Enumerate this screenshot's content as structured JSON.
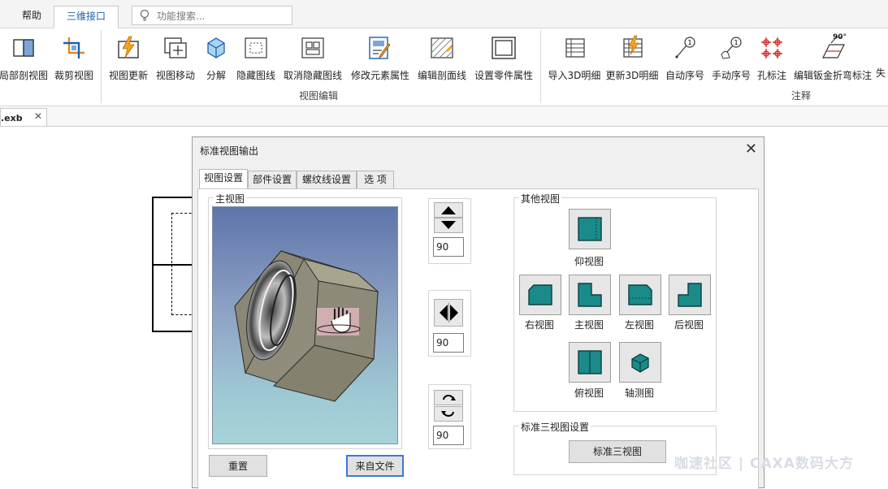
{
  "ribbon_tabs": {
    "help": "帮助",
    "three_d": "三维接口"
  },
  "search": {
    "placeholder": "功能搜索..."
  },
  "ribbon": {
    "left_buttons": [
      {
        "label": "局部剖视图",
        "icon": "partial-section-icon"
      },
      {
        "label": "裁剪视图",
        "icon": "crop-view-icon"
      }
    ],
    "view_edit_buttons": [
      {
        "label": "视图更新",
        "icon": "view-update-icon"
      },
      {
        "label": "视图移动",
        "icon": "view-move-icon"
      },
      {
        "label": "分解",
        "icon": "explode-icon"
      },
      {
        "label": "隐藏图线",
        "icon": "hide-lines-icon"
      },
      {
        "label": "取消隐藏图线",
        "icon": "unhide-lines-icon"
      },
      {
        "label": "修改元素属性",
        "icon": "edit-element-props-icon"
      },
      {
        "label": "编辑剖面线",
        "icon": "edit-hatch-icon"
      },
      {
        "label": "设置零件属性",
        "icon": "set-part-props-icon"
      }
    ],
    "annotation_buttons": [
      {
        "label": "导入3D明细",
        "icon": "import-3d-bom-icon"
      },
      {
        "label": "更新3D明细",
        "icon": "update-3d-bom-icon"
      },
      {
        "label": "自动序号",
        "icon": "auto-balloon-icon"
      },
      {
        "label": "手动序号",
        "icon": "manual-balloon-icon"
      },
      {
        "label": "孔标注",
        "icon": "hole-annotation-icon"
      },
      {
        "label": "编辑钣金折弯标注",
        "icon": "sheetmetal-bend-icon"
      },
      {
        "label": "失",
        "icon": "truncated-icon"
      }
    ],
    "groups": {
      "view_edit": "视图编辑",
      "annotation": "注释"
    },
    "bend_badge": "90°"
  },
  "document_tab": {
    "name": "冒.exb"
  },
  "dialog": {
    "title": "标准视图输出",
    "tabs": [
      "视图设置",
      "部件设置",
      "螺纹线设置",
      "选  项"
    ],
    "main_view": {
      "title": "主视图",
      "reset": "重置",
      "from_file": "来自文件"
    },
    "spinners": {
      "vertical_value": "90",
      "horizontal_value": "90",
      "rotate_value": "90"
    },
    "other_views": {
      "title": "其他视图",
      "views": [
        "仰视图",
        "右视图",
        "主视图",
        "左视图",
        "后视图",
        "俯视图",
        "轴测图"
      ]
    },
    "standard_three": {
      "title": "标准三视图设置",
      "button": "标准三视图"
    }
  },
  "watermark": "咖速社区 | CAXA数码大方",
  "colors": {
    "accent": "#1a5fb4",
    "teal": "#1b8a8a",
    "preview_top": "#5f74aa",
    "preview_bottom": "#a6d2d8"
  }
}
